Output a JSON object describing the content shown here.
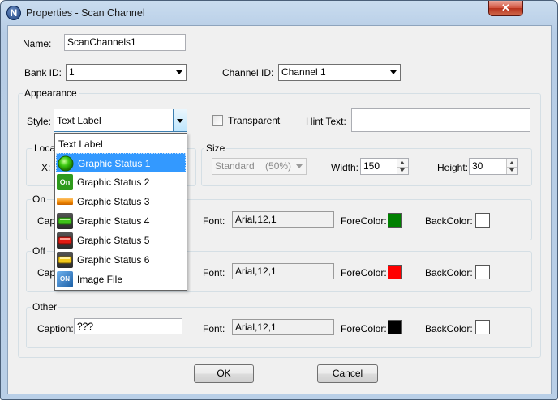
{
  "window": {
    "title": "Properties - Scan Channel",
    "app_icon": "N",
    "close_glyph": "✕"
  },
  "name_field": {
    "label": "Name:",
    "value": "ScanChannels1"
  },
  "bank_id": {
    "label": "Bank ID:",
    "value": "1"
  },
  "channel_id": {
    "label": "Channel ID:",
    "value": "Channel 1"
  },
  "appearance": {
    "group_label": "Appearance",
    "style_label": "Style:",
    "style_value": "Text Label",
    "transparent_label": "Transparent",
    "hint_label": "Hint Text:",
    "hint_value": ""
  },
  "location": {
    "group_label_partial": "Loca",
    "x_label_partial": "X:"
  },
  "size": {
    "group_label": "Size",
    "preset_value": "Standard    (50%)",
    "width_label": "Width:",
    "width_value": "150",
    "height_label": "Height:",
    "height_value": "30"
  },
  "style_dropdown": {
    "items": [
      {
        "label": "Text Label",
        "icon": "none"
      },
      {
        "label": "Graphic Status 1",
        "icon": "green-circle-icon",
        "selected": true
      },
      {
        "label": "Graphic Status 2",
        "icon": "on-badge-icon"
      },
      {
        "label": "Graphic Status 3",
        "icon": "orange-bar-icon"
      },
      {
        "label": "Graphic Status 4",
        "icon": "green-light-icon"
      },
      {
        "label": "Graphic Status 5",
        "icon": "red-light-icon"
      },
      {
        "label": "Graphic Status 6",
        "icon": "yellow-light-icon"
      },
      {
        "label": "Image File",
        "icon": "image-file-icon"
      }
    ]
  },
  "on_group": {
    "label": "On",
    "caption_label_partial": "Capt",
    "font_label": "Font:",
    "font_value": "Arial,12,1",
    "forecolor_label": "ForeColor:",
    "forecolor": "#008000",
    "backcolor_label": "BackColor:",
    "backcolor": "#ffffff"
  },
  "off_group": {
    "label": "Off",
    "caption_label_partial": "Capt",
    "font_label": "Font:",
    "font_value": "Arial,12,1",
    "forecolor_label": "ForeColor:",
    "forecolor": "#ff0000",
    "backcolor_label": "BackColor:",
    "backcolor": "#ffffff"
  },
  "other_group": {
    "label": "Other",
    "caption_label": "Caption:",
    "caption_value": "???",
    "font_label": "Font:",
    "font_value": "Arial,12,1",
    "forecolor_label": "ForeColor:",
    "forecolor": "#000000",
    "backcolor_label": "BackColor:",
    "backcolor": "#ffffff"
  },
  "buttons": {
    "ok": "OK",
    "cancel": "Cancel"
  }
}
